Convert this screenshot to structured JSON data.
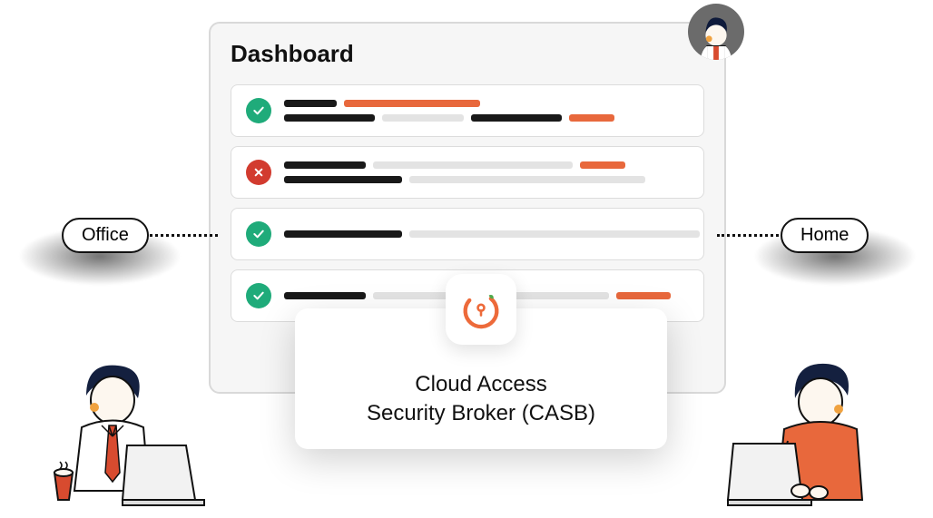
{
  "dashboard": {
    "title": "Dashboard",
    "rows": [
      {
        "status": "ok"
      },
      {
        "status": "error"
      },
      {
        "status": "ok"
      },
      {
        "status": "ok"
      }
    ]
  },
  "pills": {
    "office": "Office",
    "home": "Home"
  },
  "casb": {
    "line1": "Cloud Access",
    "line2": "Security Broker (CASB)"
  },
  "icons": {
    "check": "check-icon",
    "cross": "cross-icon",
    "avatar": "user-avatar-icon",
    "casbLogo": "casb-logo-icon"
  },
  "colors": {
    "ok": "#1fab7a",
    "error": "#d23b2f",
    "accent": "#e8683c",
    "dark": "#191919",
    "light": "#e3e3e3"
  }
}
